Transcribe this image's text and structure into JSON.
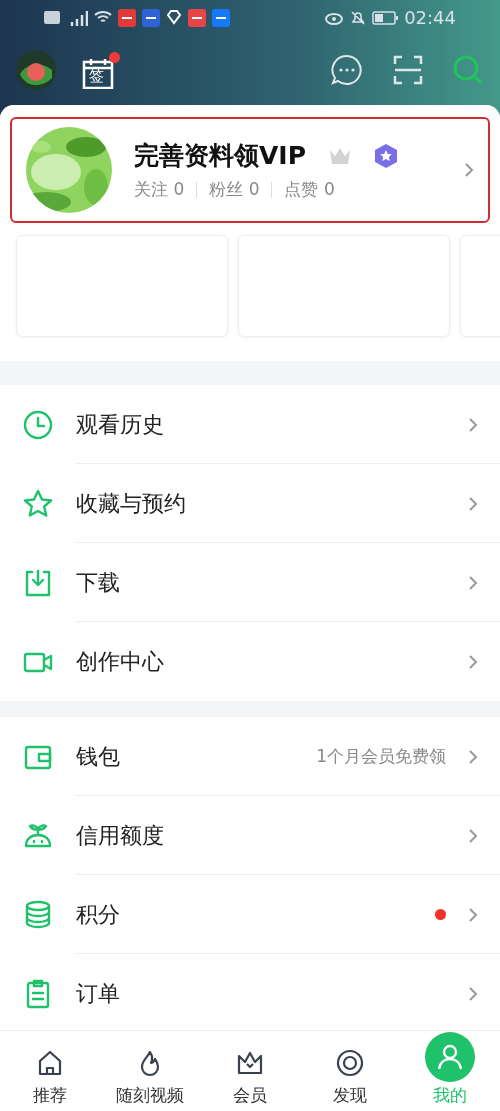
{
  "status_bar": {
    "time": "02:44"
  },
  "header": {
    "sign_badge": true,
    "sign_label": "签"
  },
  "profile": {
    "name": "完善资料领VIP",
    "stats": [
      {
        "label": "关注",
        "value": "0"
      },
      {
        "label": "粉丝",
        "value": "0"
      },
      {
        "label": "点赞",
        "value": "0"
      }
    ]
  },
  "cards": [
    {
      "kind": "blank"
    },
    {
      "kind": "blank"
    },
    {
      "kind": "blank"
    }
  ],
  "menu_groups": [
    [
      {
        "label": "观看历史",
        "dot": false
      },
      {
        "label": "收藏与预约",
        "dot": false
      },
      {
        "label": "下载",
        "dot": false
      },
      {
        "label": "创作中心",
        "dot": false
      }
    ],
    [
      {
        "label": "钱包",
        "note": "1个月会员免费领",
        "dot": false
      },
      {
        "label": "信用额度",
        "dot": false
      },
      {
        "label": "积分",
        "dot": true
      },
      {
        "label": "订单",
        "dot": false
      }
    ]
  ],
  "tabs": [
    {
      "label": "推荐",
      "selected": false
    },
    {
      "label": "随刻视频",
      "selected": false
    },
    {
      "label": "会员",
      "selected": false
    },
    {
      "label": "发现",
      "selected": false
    },
    {
      "label": "我的",
      "selected": true
    }
  ]
}
